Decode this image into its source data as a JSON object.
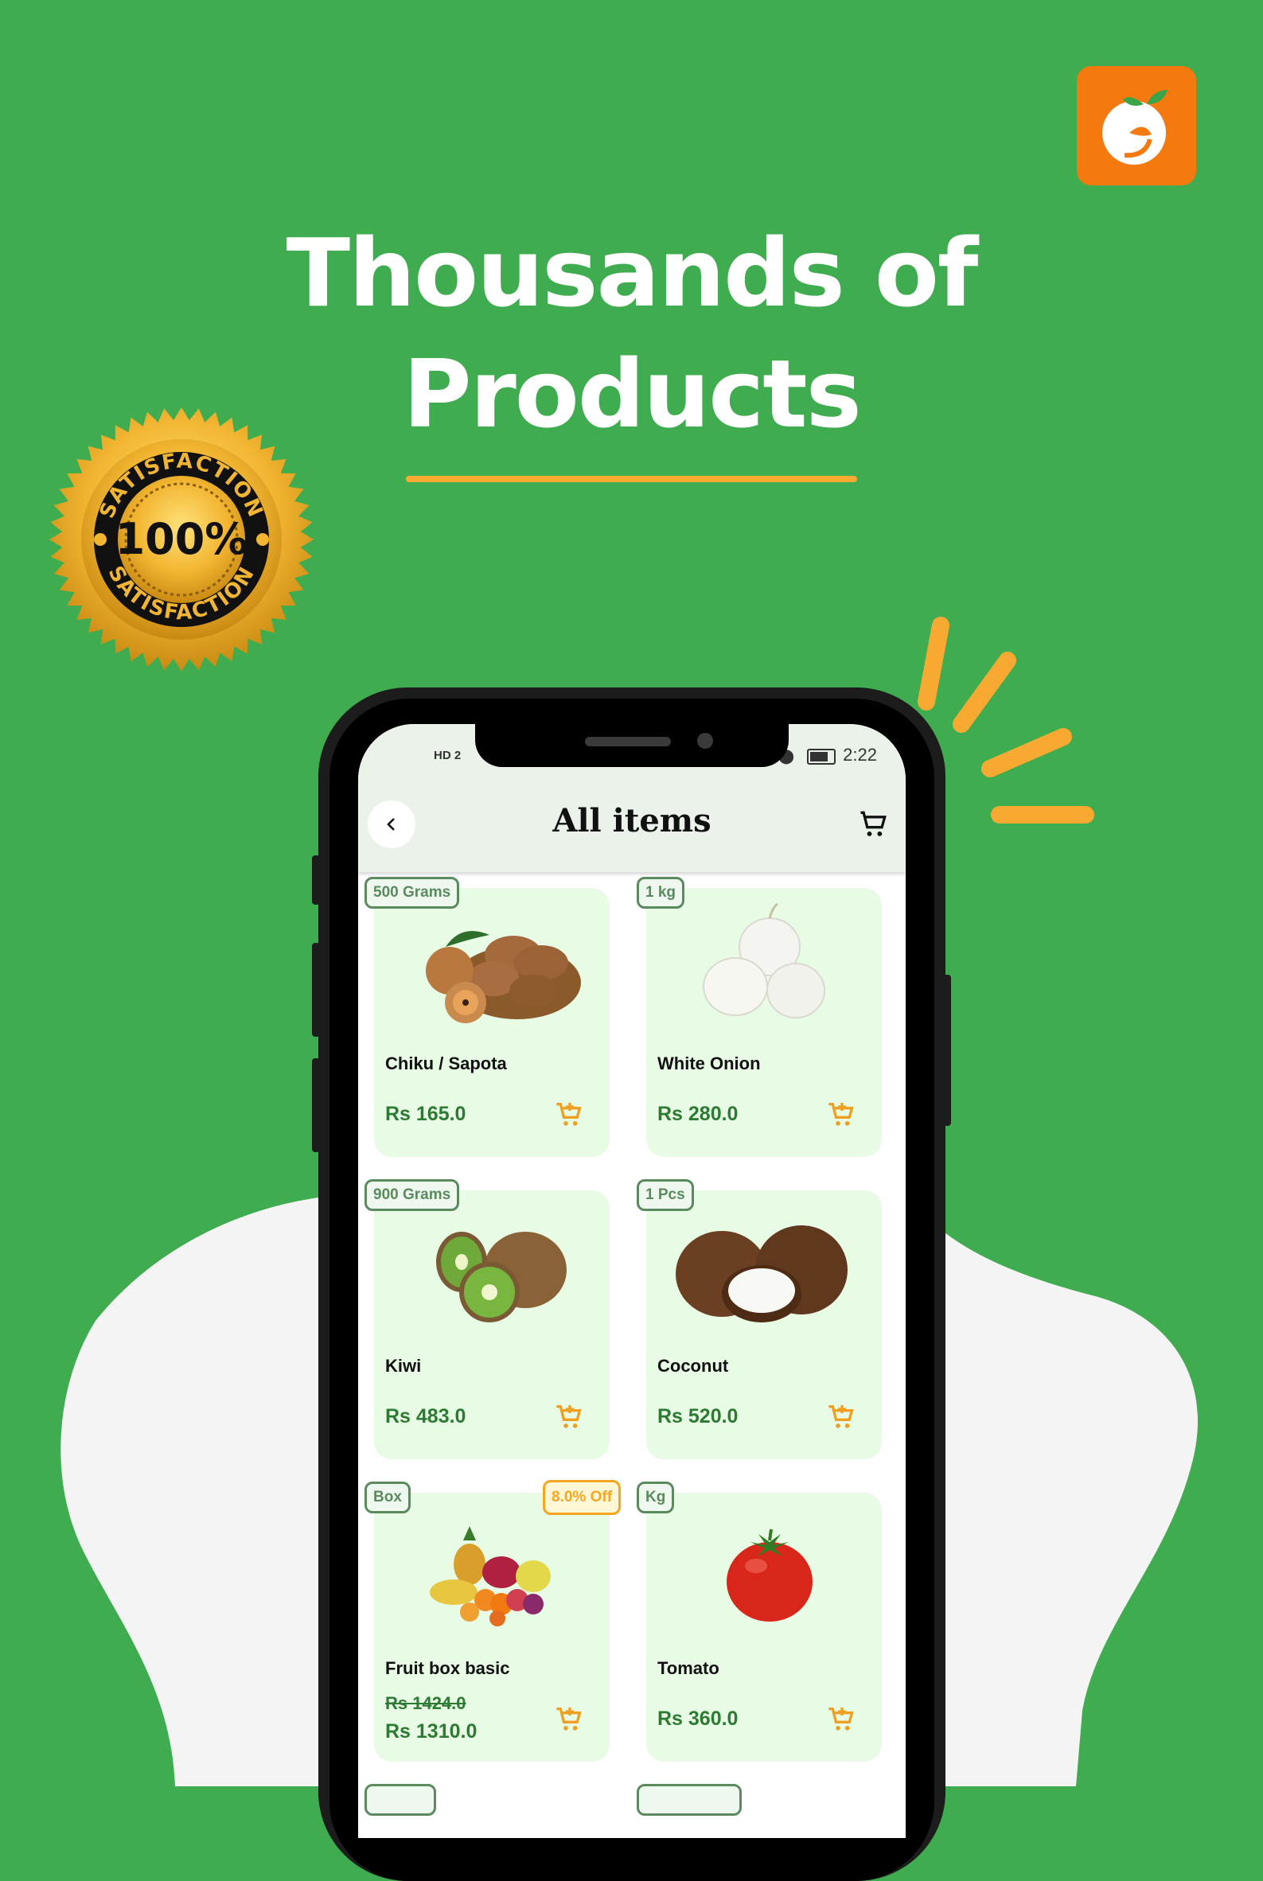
{
  "headline": {
    "line1": "Thousands of",
    "line2": "Products"
  },
  "badge": {
    "top_text": "SATISFACTION",
    "center_text": "100%",
    "bottom_text": "SATISFACTION"
  },
  "status_bar": {
    "left": "HD 2",
    "time": "2:22"
  },
  "app_bar": {
    "title": "All items",
    "back_icon": "chevron-left-icon",
    "cart_icon": "shopping-cart-icon"
  },
  "products": [
    {
      "qty": "500 Grams",
      "name": "Chiku / Sapota",
      "price": "Rs 165.0"
    },
    {
      "qty": "1 kg",
      "name": "White Onion",
      "price": "Rs 280.0"
    },
    {
      "qty": "900 Grams",
      "name": "Kiwi",
      "price": "Rs 483.0"
    },
    {
      "qty": "1 Pcs",
      "name": "Coconut",
      "price": "Rs 520.0"
    },
    {
      "qty": "Box",
      "discount": "8.0% Off",
      "name": "Fruit box basic",
      "old_price": "Rs 1424.0",
      "price": "Rs 1310.0"
    },
    {
      "qty": "Kg",
      "name": "Tomato",
      "price": "Rs 360.0"
    }
  ],
  "colors": {
    "background": "#3fac4f",
    "accent": "#f8a931",
    "card": "#e7fbe5",
    "price": "#2d7a32",
    "logo": "#f47a10"
  }
}
